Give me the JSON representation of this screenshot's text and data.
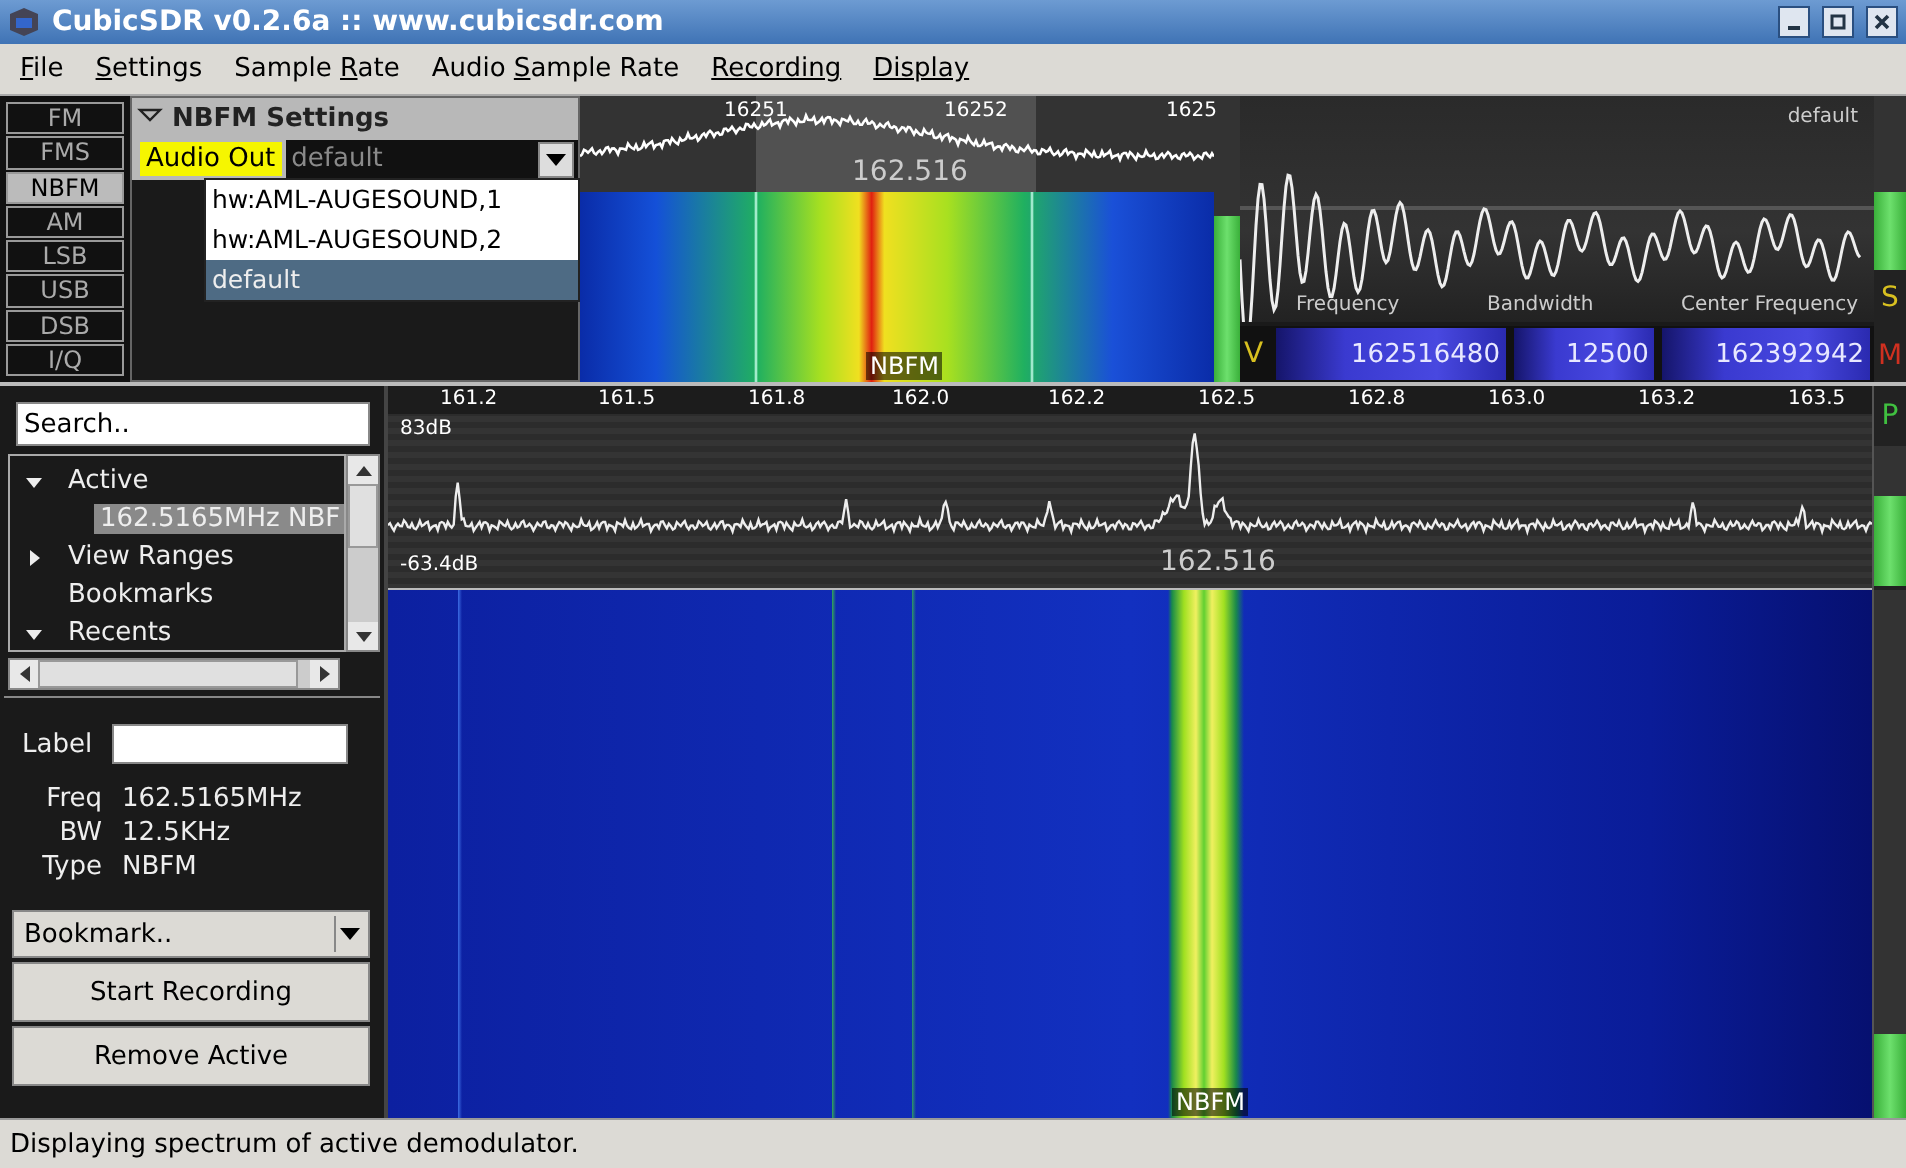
{
  "window": {
    "title": "CubicSDR v0.2.6a :: www.cubicsdr.com"
  },
  "menu": [
    {
      "key": "F",
      "post": "ile"
    },
    {
      "key": "S",
      "post": "ettings"
    },
    {
      "pre": "Sample ",
      "key": "R",
      "post": "ate"
    },
    {
      "pre": "Audio ",
      "key": "S",
      "post": "ample Rate"
    },
    {
      "key": "Recording"
    },
    {
      "key": "Display"
    }
  ],
  "modes": [
    {
      "label": "FM",
      "selected": false
    },
    {
      "label": "FMS",
      "selected": false
    },
    {
      "label": "NBFM",
      "selected": true
    },
    {
      "label": "AM",
      "selected": false
    },
    {
      "label": "LSB",
      "selected": false
    },
    {
      "label": "USB",
      "selected": false
    },
    {
      "label": "DSB",
      "selected": false
    },
    {
      "label": "I/Q",
      "selected": false
    }
  ],
  "settings": {
    "title": "NBFM Settings",
    "expanded": true,
    "audio_out_label": "Audio Out",
    "audio_out_value": "default",
    "options": [
      {
        "label": "hw:AML-AUGESOUND,1",
        "selected": false
      },
      {
        "label": "hw:AML-AUGESOUND,2",
        "selected": false
      },
      {
        "label": "default",
        "selected": true
      }
    ]
  },
  "mini_spectrum": {
    "ticks": [
      "16251",
      "16252",
      "1625"
    ],
    "center": "162.516",
    "mode": "NBFM"
  },
  "meters": {
    "demod": {
      "level": 0.58
    },
    "gain": {
      "level": 0.45
    },
    "peak": {
      "level": 0.65
    },
    "waterfall": {
      "level": 0.16
    }
  },
  "scope": {
    "device": "default",
    "labels": [
      "Frequency",
      "Bandwidth",
      "Center Frequency"
    ]
  },
  "readout": {
    "v": "V",
    "frequency": "162516480",
    "bandwidth": "12500",
    "center": "162392942",
    "m": "M",
    "s": "S"
  },
  "spectrum": {
    "top_db": "83dB",
    "ticks": [
      "161.2",
      "161.5",
      "161.8",
      "162.0",
      "162.2",
      "162.5",
      "162.8",
      "163.0",
      "163.2",
      "163.5"
    ],
    "bottom_db": "-63.4dB",
    "center": "162.516",
    "p": "P"
  },
  "waterfall": {
    "mode": "NBFM"
  },
  "sidebar": {
    "search_placeholder": "Search..",
    "tree": [
      {
        "label": "Active",
        "expanded": true,
        "selected": false,
        "children": [
          {
            "label": "162.5165MHz NBF",
            "selected": true
          }
        ]
      },
      {
        "label": "View Ranges",
        "expanded": false,
        "selected": false
      },
      {
        "label": "Bookmarks",
        "selected": false
      },
      {
        "label": "Recents",
        "expanded": true,
        "selected": false
      }
    ],
    "label_caption": "Label",
    "fields": [
      {
        "name": "Freq",
        "value": "162.5165MHz"
      },
      {
        "name": "BW",
        "value": "12.5KHz"
      },
      {
        "name": "Type",
        "value": "NBFM"
      }
    ],
    "bookmark_choice": "Bookmark..",
    "buttons": [
      "Start Recording",
      "Remove Active"
    ]
  },
  "status_bar": "Displaying spectrum of active demodulator."
}
